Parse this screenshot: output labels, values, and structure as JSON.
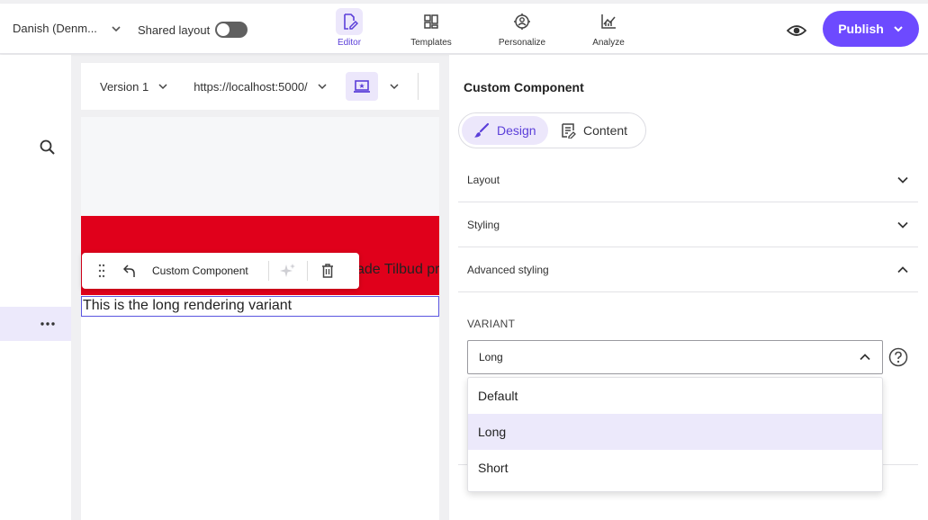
{
  "topbar": {
    "language": "Danish (Denm...",
    "shared_layout_label": "Shared layout",
    "shared_layout_enabled": false,
    "nav": [
      {
        "label": "Editor",
        "icon": "editor-icon",
        "active": true
      },
      {
        "label": "Templates",
        "icon": "templates-icon",
        "active": false
      },
      {
        "label": "Personalize",
        "icon": "personalize-icon",
        "active": false
      },
      {
        "label": "Analyze",
        "icon": "analyze-icon",
        "active": false
      }
    ],
    "publish_label": "Publish"
  },
  "preview": {
    "version_label": "Version 1",
    "url": "https://localhost:5000/",
    "device_icon": "laptop-icon",
    "red_banner_text": "ade Tilbud pr",
    "variant_text": "This is the long rendering variant",
    "component_toolbar_label": "Custom Component"
  },
  "panel": {
    "title": "Custom Component",
    "tabs": [
      {
        "label": "Design",
        "icon": "brush-icon",
        "active": true
      },
      {
        "label": "Content",
        "icon": "content-icon",
        "active": false
      }
    ],
    "sections": [
      {
        "label": "Layout",
        "expanded": false
      },
      {
        "label": "Styling",
        "expanded": false
      },
      {
        "label": "Advanced styling",
        "expanded": true
      }
    ],
    "variant_label": "VARIANT",
    "variant_value": "Long",
    "options": [
      "Default",
      "Long",
      "Short"
    ],
    "selected_option": "Long"
  },
  "colors": {
    "accent": "#6d4aff",
    "accent_light": "#ece7fb",
    "banner_red": "#e0001b",
    "selection_outline": "#5a55e0"
  }
}
